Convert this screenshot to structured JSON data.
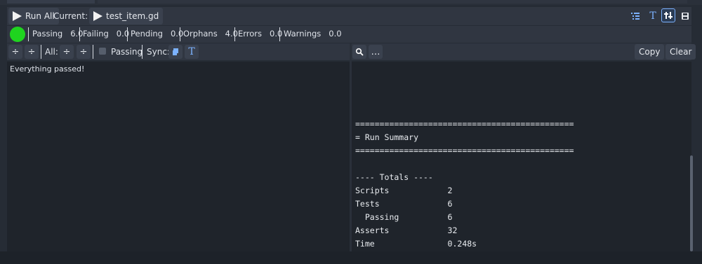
{
  "toolbar": {
    "run_all_label": "Run All",
    "current_label": "Current:",
    "current_script": "test_item.gd",
    "right_icons": [
      "outline-icon",
      "text-format-icon",
      "settings-sliders-icon",
      "panel-save-icon"
    ]
  },
  "summary": {
    "status_color": "#1fd41f",
    "stats": [
      {
        "label": "Passing",
        "value": "6.0"
      },
      {
        "label": "Failing",
        "value": "0.0"
      },
      {
        "label": "Pending",
        "value": "0.0"
      },
      {
        "label": "Orphans",
        "value": "4.0"
      },
      {
        "label": "Errors",
        "value": "0.0"
      },
      {
        "label": "Warnings",
        "value": "0.0"
      }
    ]
  },
  "controls": {
    "all_label": "All:",
    "passing_label": "Passing",
    "sync_label": "Sync:",
    "search_label": "…",
    "copy_label": "Copy",
    "clear_label": "Clear"
  },
  "tree": {
    "message": "Everything passed!"
  },
  "output": {
    "lines": [
      "=============================================",
      "= Run Summary",
      "=============================================",
      "",
      "---- Totals ----",
      "Scripts            2",
      "Tests              6",
      "  Passing          6",
      "Asserts            32",
      "Time               0.248s"
    ]
  }
}
